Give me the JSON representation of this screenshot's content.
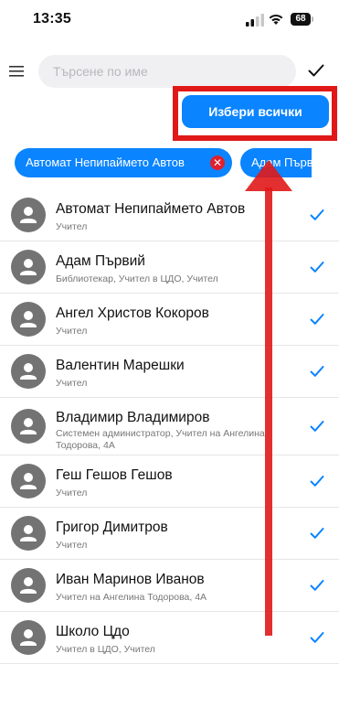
{
  "status_bar": {
    "time": "13:35",
    "battery": "68"
  },
  "search": {
    "placeholder": "Търсене по име"
  },
  "select_all_label": "Избери всички",
  "chips": [
    {
      "label": "Автомат Непипаймето Автов"
    },
    {
      "label": "Адам Първ"
    }
  ],
  "people": [
    {
      "name": "Автомат Непипаймето Автов",
      "role": "Учител"
    },
    {
      "name": "Адам Първий",
      "role": "Библиотекар, Учител в ЦДО, Учител"
    },
    {
      "name": "Ангел Христов Кокоров",
      "role": "Учител"
    },
    {
      "name": "Валентин Марешки",
      "role": "Учител"
    },
    {
      "name": "Владимир Владимиров",
      "role": "Системен администратор, Учител на Ангелина Тодорова, 4А"
    },
    {
      "name": "Геш Гешов Гешов",
      "role": "Учител"
    },
    {
      "name": "Григор Димитров",
      "role": "Учител"
    },
    {
      "name": "Иван Маринов Иванов",
      "role": "Учител на Ангелина Тодорова, 4А"
    },
    {
      "name": "Школо Цдо",
      "role": "Учител в ЦДО, Учител"
    }
  ],
  "colors": {
    "accent": "#0a84ff",
    "highlight": "#e01818",
    "remove_badge": "#e0202f"
  }
}
